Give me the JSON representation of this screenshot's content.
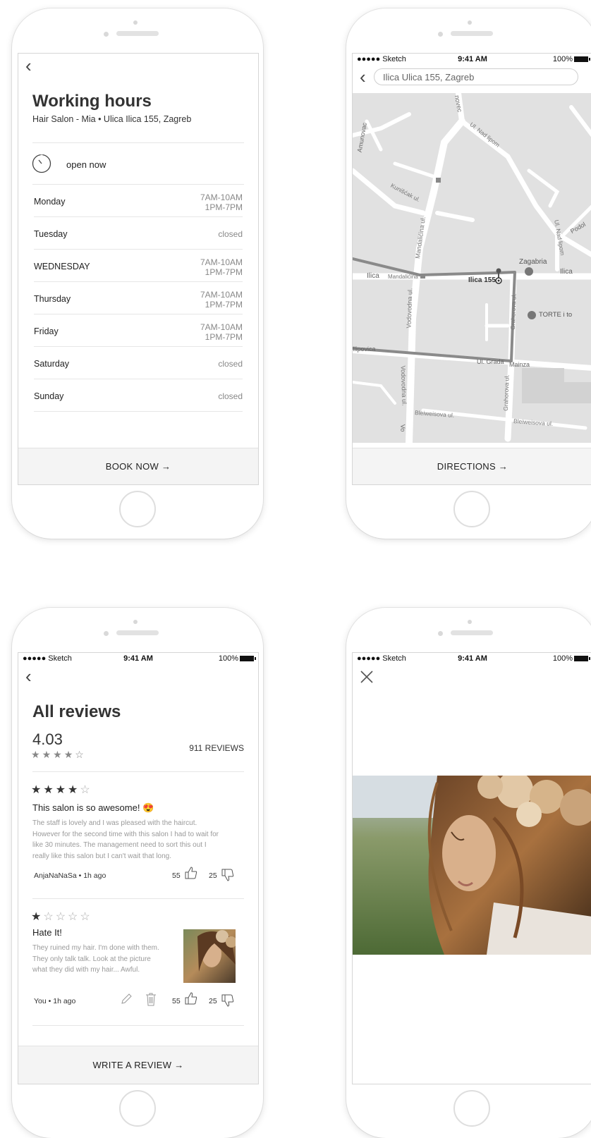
{
  "status": {
    "carrier": "●●●●● Sketch",
    "time": "9:41 AM",
    "battery": "100%"
  },
  "hours_screen": {
    "title": "Working hours",
    "subtitle": "Hair Salon - Mia • Ulica Ilica 155, Zagreb",
    "open_label": "open now",
    "days": [
      {
        "day": "Monday",
        "hours": "7AM-10AM\n1PM-7PM"
      },
      {
        "day": "Tuesday",
        "hours": "closed"
      },
      {
        "day": "WEDNESDAY",
        "hours": "7AM-10AM\n1PM-7PM"
      },
      {
        "day": "Thursday",
        "hours": "7AM-10AM\n1PM-7PM"
      },
      {
        "day": "Friday",
        "hours": "7AM-10AM\n1PM-7PM"
      },
      {
        "day": "Saturday",
        "hours": "closed"
      },
      {
        "day": "Sunday",
        "hours": "closed"
      }
    ],
    "button": "BOOK NOW →"
  },
  "map_screen": {
    "search_value": "Ilica Ulica 155, Zagreb",
    "labels": {
      "ilica_155": "Ilica 155",
      "zagabria": "Zagabria",
      "torte": "TORTE i to",
      "ilica": "Ilica",
      "ilica_right": "Ilica",
      "mandalicina": "Mandalićina ul.",
      "vodovodna": "Vodovodna ul.",
      "vodovodna2": "Vodovodna ul.",
      "grahorova": "Grahorova ul.",
      "grahorova2": "Grahorova ul.",
      "nad_lipom": "Ul. Nad lipom",
      "nad_lipom2": "Ul. Nad lipom",
      "kunisciak": "Kunišćak ul.",
      "bleiweisova": "Bleiweisova ul.",
      "bleiweisova2": "Bleiweisova ul.",
      "mainza": "Mainza",
      "ul_grada": "Ul. Grada",
      "ilipovica": "Ilipovica",
      "novec": "novec",
      "amunovac": "Amunovac",
      "mandalicina_small": "Mandalićina",
      "podolje": "Podol",
      "vo": "Vo"
    },
    "button": "DIRECTIONS →"
  },
  "reviews_screen": {
    "title": "All reviews",
    "rating": "4.03",
    "rating_stars": 4,
    "reviews_count": "911 REVIEWS",
    "reviews": [
      {
        "stars": 4,
        "title": "This salon is so awesome! 😍",
        "body_lines": [
          "The staff is lovely and I was pleased with the haircut.",
          "However for the second time with this salon I had to wait for",
          "like 30 minutes. The management need to sort this out I",
          "really like this salon but I can't wait that long."
        ],
        "meta": "AnjaNaNaSa • 1h ago",
        "likes": "55",
        "dislikes": "25"
      },
      {
        "stars": 1,
        "title": "Hate It!",
        "body_lines": [
          "They ruined my hair. I'm done with them.",
          "They only talk talk. Look at the picture",
          "what they did with my hair... Awful."
        ],
        "meta": "You • 1h ago",
        "likes": "55",
        "dislikes": "25"
      }
    ],
    "button": "WRITE A REVIEW →"
  },
  "colors": {
    "accent_dark": "#333333",
    "muted": "#8b8b8b",
    "map_bg": "#e1e1e1",
    "route": "#8a8a8a"
  }
}
